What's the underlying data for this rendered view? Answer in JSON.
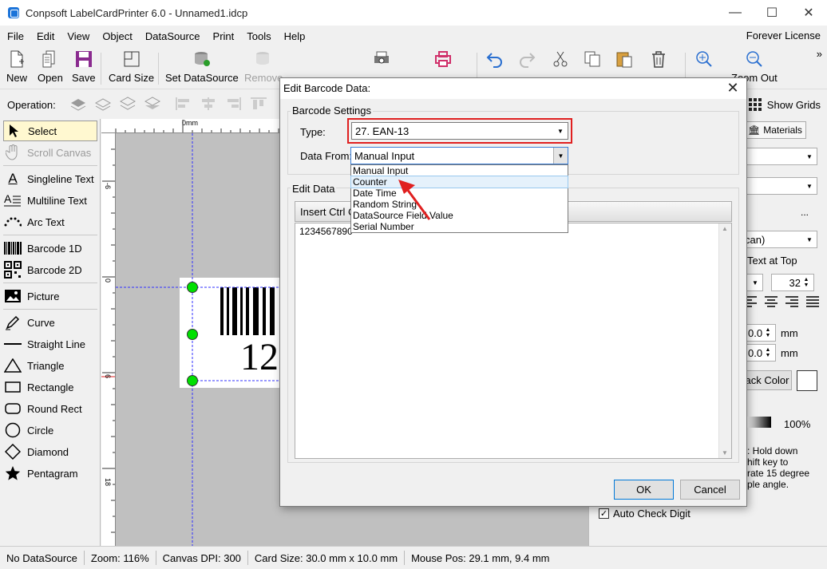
{
  "window": {
    "title": "Conpsoft LabelCardPrinter 6.0 - Unnamed1.idcp"
  },
  "menu": {
    "items": [
      "File",
      "Edit",
      "View",
      "Object",
      "DataSource",
      "Print",
      "Tools",
      "Help"
    ],
    "license": "Forever License"
  },
  "toolbar": {
    "new": "New",
    "open": "Open",
    "save": "Save",
    "card_size": "Card Size",
    "set_datasource": "Set DataSource",
    "remove": "Remove",
    "de": "De S",
    "print_preview": "Print Preview",
    "print_direct": "Print Direct",
    "undo": "Undo",
    "redo": "Redo",
    "cut": "Cut",
    "copy": "Copy",
    "paste": "Paste",
    "delete": "Delete",
    "zoom_in": "Zoom In",
    "zoom_out": "Zoom Out",
    "overflow": "»"
  },
  "operation": {
    "label": "Operation:",
    "show_grids": "Show Grids"
  },
  "tools": {
    "select": "Select",
    "scroll_canvas": "Scroll Canvas",
    "singleline_text": "Singleline Text",
    "multiline_text": "Multiline Text",
    "arc_text": "Arc Text",
    "barcode_1d": "Barcode 1D",
    "barcode_2d": "Barcode 2D",
    "picture": "Picture",
    "curve": "Curve",
    "straight_line": "Straight Line",
    "triangle": "Triangle",
    "rectangle": "Rectangle",
    "round_rect": "Round Rect",
    "circle": "Circle",
    "diamond": "Diamond",
    "pentagram": "Pentagram"
  },
  "canvas": {
    "ruler_h_label": "0mm",
    "ruler_v_labels": [
      "-6",
      "0",
      "6",
      "12",
      "18"
    ],
    "barcode_text": "12"
  },
  "right_panel": {
    "materials_tab": "Materials",
    "ellipsis": "...",
    "scan_suffix": "can)",
    "text_at_top": "Text at Top",
    "font_size": "32",
    "mm1_value": "0.0",
    "mm2_value": "0.0",
    "unit": "mm",
    "back_color": "ack Color",
    "percent": "100%",
    "hint_lines": [
      ": Hold down",
      "hift key to",
      "rate 15 degree",
      "ple angle."
    ],
    "auto_check_digit": "Auto Check Digit"
  },
  "status": {
    "datasource": "No DataSource",
    "zoom": "Zoom: 116%",
    "dpi": "Canvas DPI: 300",
    "card_size": "Card Size: 30.0 mm x 10.0 mm",
    "mouse_pos": "Mouse Pos: 29.1 mm, 9.4 mm"
  },
  "dialog": {
    "title": "Edit Barcode Data:",
    "settings_group": "Barcode Settings",
    "type_label": "Type:",
    "type_value": "27.  EAN-13",
    "data_from_label": "Data From:",
    "data_from_value": "Manual Input",
    "data_from_options": [
      "Manual Input",
      "Counter",
      "Date Time",
      "Random String",
      "DataSource Field Value",
      "Serial Number"
    ],
    "edit_group": "Edit Data",
    "insert_ctrl": "Insert Ctrl C",
    "data_value": "1234567890",
    "ok": "OK",
    "cancel": "Cancel"
  },
  "colors": {
    "highlight": "#e02020",
    "handle": "#00e000",
    "guide": "#3030ff"
  }
}
